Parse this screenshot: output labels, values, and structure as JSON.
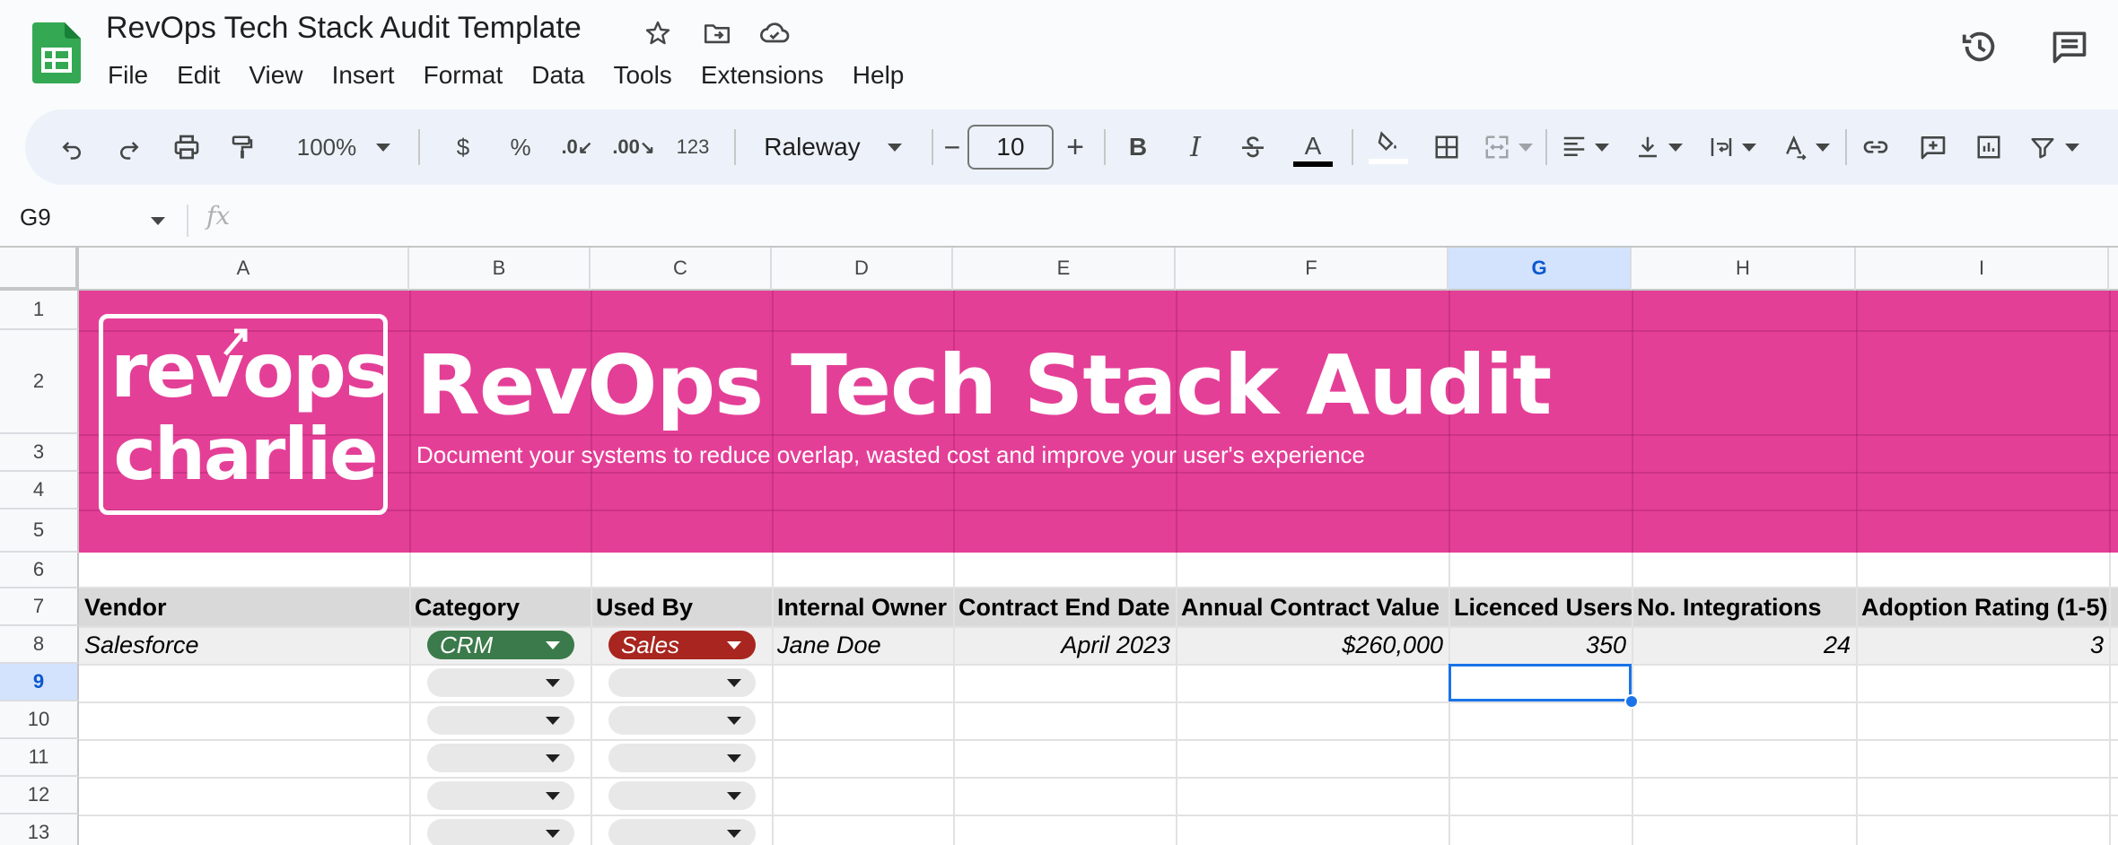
{
  "app": {
    "title": "RevOps Tech Stack Audit Template",
    "icons": {
      "logo": "google-sheets-logo",
      "star": "star-icon",
      "move": "move-to-folder-icon",
      "cloud": "cloud-saved-icon",
      "history": "version-history-icon",
      "comments": "comments-icon"
    }
  },
  "menu": [
    "File",
    "Edit",
    "View",
    "Insert",
    "Format",
    "Data",
    "Tools",
    "Extensions",
    "Help"
  ],
  "toolbar": {
    "zoom": "100%",
    "currency": "$",
    "percent": "%",
    "decrease_decimal": ".0",
    "increase_decimal": ".00",
    "more_formats": "123",
    "font": "Raleway",
    "font_size": "10",
    "minus": "−",
    "plus": "+",
    "bold": "B",
    "italic": "I",
    "text_color_label": "A"
  },
  "formula_bar": {
    "cell_ref": "G9",
    "fx": "fx",
    "value": ""
  },
  "columns": [
    "A",
    "B",
    "C",
    "D",
    "E",
    "F",
    "G",
    "H",
    "I"
  ],
  "rows": [
    "1",
    "2",
    "3",
    "4",
    "5",
    "6",
    "7",
    "8",
    "9",
    "10",
    "11",
    "12",
    "13"
  ],
  "banner": {
    "logo_line1": "revops",
    "logo_line2": "charlie",
    "title": "RevOps Tech Stack Audit",
    "subtitle": "Document your systems to reduce overlap, wasted cost and improve your user's experience",
    "color": "#e43f97"
  },
  "table": {
    "headers": [
      "Vendor",
      "Category",
      "Used By",
      "Internal Owner",
      "Contract End Date",
      "Annual Contract Value",
      "Licenced Users",
      "No. Integrations",
      "Adoption Rating (1-5)"
    ],
    "row": {
      "vendor": "Salesforce",
      "category": "CRM",
      "used_by": "Sales",
      "owner": "Jane Doe",
      "end_date": "April 2023",
      "value": "$260,000",
      "users": "350",
      "integrations": "24",
      "rating": "3"
    },
    "category_chip_color": "#3b7a4a",
    "used_by_chip_color": "#a8261f"
  },
  "selected_cell": "G9",
  "accent": "#1a73e8"
}
